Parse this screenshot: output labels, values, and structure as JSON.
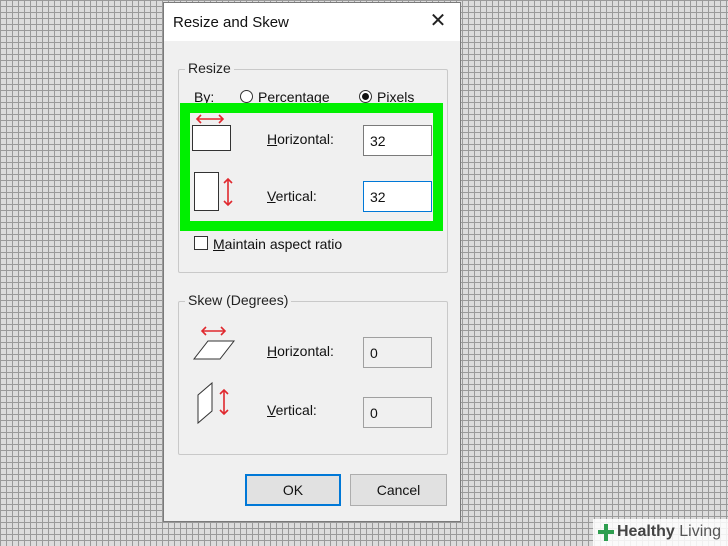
{
  "dialog": {
    "title": "Resize and Skew",
    "close_glyph": "✕"
  },
  "resize": {
    "group_label": "Resize",
    "by_label": "By:",
    "options": [
      {
        "label": "Percentage",
        "selected": false
      },
      {
        "label": "Pixels",
        "selected": true
      }
    ],
    "horizontal_label": "Horizontal:",
    "horizontal_value": "32",
    "vertical_label": "Vertical:",
    "vertical_value": "32",
    "maintain_aspect_label": "Maintain aspect ratio",
    "maintain_aspect_checked": false
  },
  "skew": {
    "group_label": "Skew (Degrees)",
    "horizontal_label": "Horizontal:",
    "horizontal_value": "0",
    "vertical_label": "Vertical:",
    "vertical_value": "0"
  },
  "buttons": {
    "ok_label": "OK",
    "cancel_label": "Cancel"
  },
  "watermark": {
    "brand_bold": "Healthy",
    "brand_light": "Living"
  },
  "colors": {
    "highlight": "#00f000",
    "arrow_red": "#e0282e",
    "focus_blue": "#0078d7",
    "watermark_green": "#2e9e4f"
  },
  "icons": [
    "close-icon",
    "resize-horizontal-icon",
    "resize-vertical-icon",
    "skew-horizontal-icon",
    "skew-vertical-icon",
    "healthy-living-logo-icon"
  ]
}
